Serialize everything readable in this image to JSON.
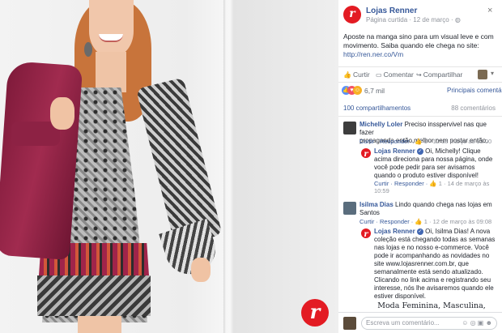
{
  "brand": {
    "accent": "#e31b23",
    "link": "#365899",
    "logo_letter": "r"
  },
  "post": {
    "page_name": "Lojas Renner",
    "meta": "Página curtida · 12 de março · ",
    "text_line1": "Aposte na manga sino para um visual leve e com",
    "text_line2": "movimento. Saiba quando ele chega no site:",
    "link": "http://ren.ner.co/Vm",
    "close": "×"
  },
  "actions": {
    "like": "Curtir",
    "comment": "Comentar",
    "share": "Compartilhar"
  },
  "reactions": {
    "count": "6,7 mil",
    "relevant": "Principais comentários ▾"
  },
  "counts": {
    "shares": "100 compartilhamentos",
    "comments": "88 comentários"
  },
  "comments": [
    {
      "author": "Michelly Loler",
      "text_line1": "Preciso insspervivel nas que fazer",
      "text_line2": "propaganda então,melhor nem postar então.",
      "sub_actions": "Curtir · Responder · ",
      "sub_meta": " 1 · 12 de março às 13:00"
    },
    {
      "author": "Lojas Renner",
      "lines": [
        "Oi, Michelly! Clique",
        "acima direciona para nossa página, onde",
        "você pode pedir para ser avisamos",
        "quando o produto estiver disponível!"
      ],
      "sub_line1": "Curtir · Responder · ",
      "sub_meta": " 1 · 14 de março às",
      "sub_line2": "10:59"
    },
    {
      "author": "Isilma Dias",
      "text_line1": "Lindo quando chega nas lojas em",
      "text_line2": "Santos",
      "sub_actions": "Curtir · Responder · ",
      "sub_meta": " 1 · 12 de março às 09:08"
    },
    {
      "author": "Lojas Renner",
      "lines": [
        "Oi, Isilma Dias! A nova",
        "coleção está chegando todas as semanas",
        "nas lojas e no nosso e-commerce. Você",
        "pode ir acompanhando as novidades no",
        "site www.lojasrenner.com.br, que",
        "semanalmente está sendo atualizado.",
        "Clicando no link acima e registrando seu",
        "interesse, nós lhe avisaremos quando ele",
        "estiver disponível."
      ]
    }
  ],
  "promo_text": "Moda Feminina, Masculina,",
  "write_placeholder": "Escreva um comentário...",
  "write_icons": "☺ ◎ ▣ ☻",
  "icons": [
    "like-icon",
    "comment-icon",
    "share-icon",
    "close-icon",
    "verified-icon",
    "camera-icon",
    "emoji-icon"
  ]
}
